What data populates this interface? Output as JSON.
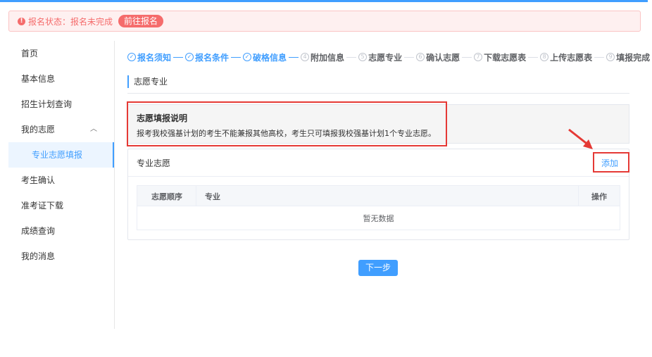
{
  "alert": {
    "status_text": "报名状态：报名未完成",
    "action_tag": "前往报名"
  },
  "sidebar": {
    "items": [
      {
        "label": "首页"
      },
      {
        "label": "基本信息"
      },
      {
        "label": "招生计划查询"
      },
      {
        "label": "我的志愿"
      },
      {
        "label": "专业志愿填报"
      },
      {
        "label": "考生确认"
      },
      {
        "label": "准考证下载"
      },
      {
        "label": "成绩查询"
      },
      {
        "label": "我的消息"
      }
    ]
  },
  "steps": [
    {
      "label": "报名须知",
      "num": "✓",
      "done": true
    },
    {
      "label": "报名条件",
      "num": "✓",
      "done": true
    },
    {
      "label": "破格信息",
      "num": "✓",
      "done": true
    },
    {
      "label": "附加信息",
      "num": "4",
      "done": false
    },
    {
      "label": "志愿专业",
      "num": "5",
      "done": false
    },
    {
      "label": "确认志愿",
      "num": "6",
      "done": false
    },
    {
      "label": "下载志愿表",
      "num": "7",
      "done": false
    },
    {
      "label": "上传志愿表",
      "num": "8",
      "done": false
    },
    {
      "label": "填报完成",
      "num": "9",
      "done": false
    }
  ],
  "section_title": "志愿专业",
  "info": {
    "title": "志愿填报说明",
    "desc": "报考我校强基计划的考生不能兼报其他高校，考生只可填报我校强基计划1个专业志愿。"
  },
  "card": {
    "title": "专业志愿",
    "add_label": "添加"
  },
  "table": {
    "columns": [
      "志愿顺序",
      "专业",
      "操作"
    ],
    "empty_text": "暂无数据"
  },
  "next_button": "下一步",
  "colors": {
    "accent": "#409eff",
    "danger": "#f56c6c",
    "highlight": "#e53935"
  }
}
